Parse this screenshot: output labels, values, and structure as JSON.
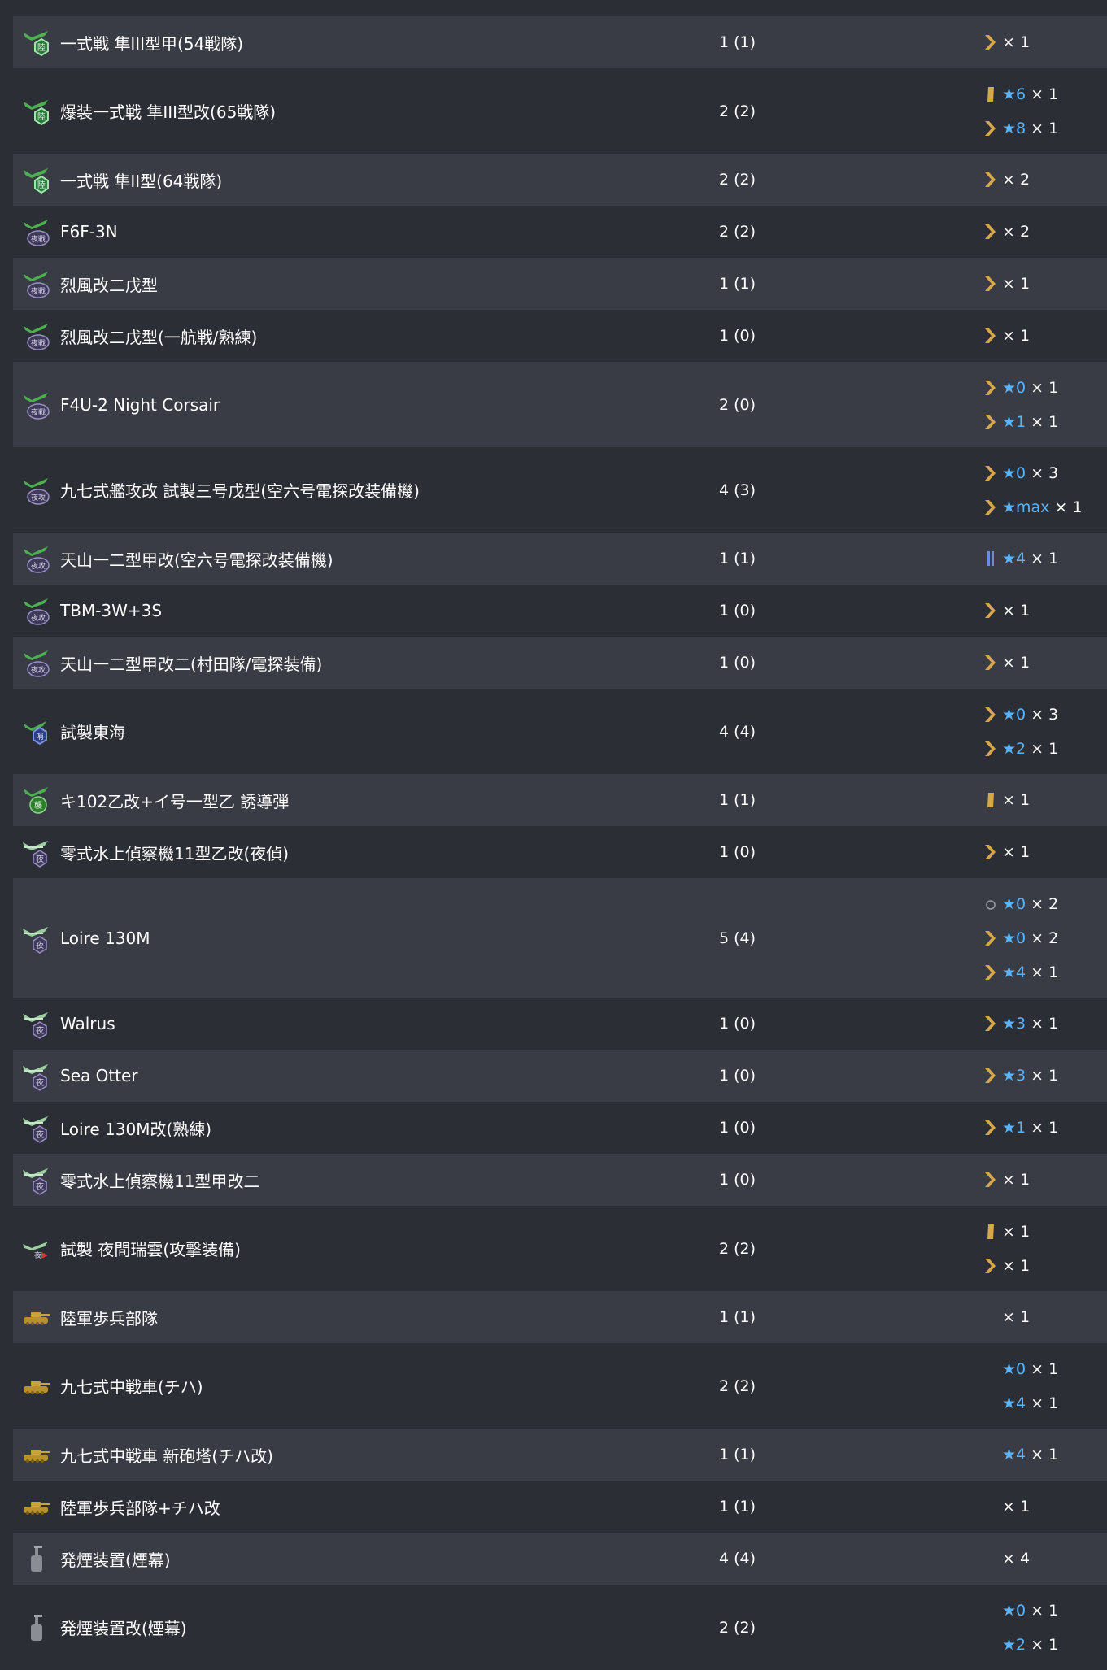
{
  "colors": {
    "bg": "#2b2e35",
    "row_alt": "#393c44",
    "text": "#ffffff",
    "star": "#5ab4ff",
    "chevron": "#d6a84a",
    "bar_blue": "#6a8dd6"
  },
  "rows": [
    {
      "icon": "fighter-ground-icon",
      "name": "一式戦 隼III型甲(54戦隊)",
      "count": "1 (1)",
      "prof": [
        {
          "badge": "chevron",
          "star": "",
          "mult": "× 1"
        }
      ]
    },
    {
      "icon": "fighter-ground-icon",
      "name": "爆装一式戦 隼III型改(65戦隊)",
      "count": "2 (2)",
      "prof": [
        {
          "badge": "bar-gold",
          "star": "★6",
          "mult": "× 1"
        },
        {
          "badge": "chevron",
          "star": "★8",
          "mult": "× 1"
        }
      ]
    },
    {
      "icon": "fighter-ground-icon",
      "name": "一式戦 隼II型(64戦隊)",
      "count": "2 (2)",
      "prof": [
        {
          "badge": "chevron",
          "star": "",
          "mult": "× 2"
        }
      ]
    },
    {
      "icon": "night-fighter-icon",
      "name": "F6F-3N",
      "count": "2 (2)",
      "prof": [
        {
          "badge": "chevron",
          "star": "",
          "mult": "× 2"
        }
      ]
    },
    {
      "icon": "night-fighter-icon",
      "name": "烈風改二戊型",
      "count": "1 (1)",
      "prof": [
        {
          "badge": "chevron",
          "star": "",
          "mult": "× 1"
        }
      ]
    },
    {
      "icon": "night-fighter-icon",
      "name": "烈風改二戊型(一航戦/熟練)",
      "count": "1 (0)",
      "prof": [
        {
          "badge": "chevron",
          "star": "",
          "mult": "× 1"
        }
      ]
    },
    {
      "icon": "night-fighter-icon",
      "name": "F4U-2 Night Corsair",
      "count": "2 (0)",
      "prof": [
        {
          "badge": "chevron",
          "star": "★0",
          "mult": "× 1"
        },
        {
          "badge": "chevron",
          "star": "★1",
          "mult": "× 1"
        }
      ]
    },
    {
      "icon": "night-attacker-icon",
      "name": "九七式艦攻改 試製三号戊型(空六号電探改装備機)",
      "count": "4 (3)",
      "prof": [
        {
          "badge": "chevron",
          "star": "★0",
          "mult": "× 3"
        },
        {
          "badge": "chevron",
          "star": "★max",
          "mult": "× 1"
        }
      ]
    },
    {
      "icon": "night-attacker-icon",
      "name": "天山一二型甲改(空六号電探改装備機)",
      "count": "1 (1)",
      "prof": [
        {
          "badge": "bar-blue",
          "star": "★4",
          "mult": "× 1"
        }
      ]
    },
    {
      "icon": "night-attacker-icon",
      "name": "TBM-3W+3S",
      "count": "1 (0)",
      "prof": [
        {
          "badge": "chevron",
          "star": "",
          "mult": "× 1"
        }
      ]
    },
    {
      "icon": "night-attacker-icon",
      "name": "天山一二型甲改二(村田隊/電探装備)",
      "count": "1 (0)",
      "prof": [
        {
          "badge": "chevron",
          "star": "",
          "mult": "× 1"
        }
      ]
    },
    {
      "icon": "patrol-plane-icon",
      "name": "試製東海",
      "count": "4 (4)",
      "prof": [
        {
          "badge": "chevron",
          "star": "★0",
          "mult": "× 3"
        },
        {
          "badge": "chevron",
          "star": "★2",
          "mult": "× 1"
        }
      ]
    },
    {
      "icon": "attack-plane-icon",
      "name": "キ102乙改+イ号一型乙 誘導弾",
      "count": "1 (1)",
      "prof": [
        {
          "badge": "bar-gold",
          "star": "",
          "mult": "× 1"
        }
      ]
    },
    {
      "icon": "night-seaplane-icon",
      "name": "零式水上偵察機11型乙改(夜偵)",
      "count": "1 (0)",
      "prof": [
        {
          "badge": "chevron",
          "star": "",
          "mult": "× 1"
        }
      ]
    },
    {
      "icon": "night-seaplane-icon",
      "name": "Loire 130M",
      "count": "5 (4)",
      "prof": [
        {
          "badge": "circle",
          "star": "★0",
          "mult": "× 2"
        },
        {
          "badge": "chevron",
          "star": "★0",
          "mult": "× 2"
        },
        {
          "badge": "chevron",
          "star": "★4",
          "mult": "× 1"
        }
      ]
    },
    {
      "icon": "night-seaplane-icon",
      "name": "Walrus",
      "count": "1 (0)",
      "prof": [
        {
          "badge": "chevron",
          "star": "★3",
          "mult": "× 1"
        }
      ]
    },
    {
      "icon": "night-seaplane-icon",
      "name": "Sea Otter",
      "count": "1 (0)",
      "prof": [
        {
          "badge": "chevron",
          "star": "★3",
          "mult": "× 1"
        }
      ]
    },
    {
      "icon": "night-seaplane-icon",
      "name": "Loire 130M改(熟練)",
      "count": "1 (0)",
      "prof": [
        {
          "badge": "chevron",
          "star": "★1",
          "mult": "× 1"
        }
      ]
    },
    {
      "icon": "night-seaplane-icon",
      "name": "零式水上偵察機11型甲改二",
      "count": "1 (0)",
      "prof": [
        {
          "badge": "chevron",
          "star": "",
          "mult": "× 1"
        }
      ]
    },
    {
      "icon": "night-bomber-icon",
      "name": "試製 夜間瑞雲(攻撃装備)",
      "count": "2 (2)",
      "prof": [
        {
          "badge": "bar-gold",
          "star": "",
          "mult": "× 1"
        },
        {
          "badge": "chevron",
          "star": "",
          "mult": "× 1"
        }
      ]
    },
    {
      "icon": "tank-icon",
      "name": "陸軍歩兵部隊",
      "count": "1 (1)",
      "prof": [
        {
          "badge": "",
          "star": "",
          "mult": "× 1"
        }
      ]
    },
    {
      "icon": "tank-icon",
      "name": "九七式中戦車(チハ)",
      "count": "2 (2)",
      "prof": [
        {
          "badge": "",
          "star": "★0",
          "mult": "× 1"
        },
        {
          "badge": "",
          "star": "★4",
          "mult": "× 1"
        }
      ]
    },
    {
      "icon": "tank-icon",
      "name": "九七式中戦車 新砲塔(チハ改)",
      "count": "1 (1)",
      "prof": [
        {
          "badge": "",
          "star": "★4",
          "mult": "× 1"
        }
      ]
    },
    {
      "icon": "tank-icon",
      "name": "陸軍歩兵部隊+チハ改",
      "count": "1 (1)",
      "prof": [
        {
          "badge": "",
          "star": "",
          "mult": "× 1"
        }
      ]
    },
    {
      "icon": "smoke-generator-icon",
      "name": "発煙装置(煙幕)",
      "count": "4 (4)",
      "prof": [
        {
          "badge": "",
          "star": "",
          "mult": "× 4"
        }
      ]
    },
    {
      "icon": "smoke-generator-icon",
      "name": "発煙装置改(煙幕)",
      "count": "2 (2)",
      "prof": [
        {
          "badge": "",
          "star": "★0",
          "mult": "× 1"
        },
        {
          "badge": "",
          "star": "★2",
          "mult": "× 1"
        }
      ]
    }
  ]
}
